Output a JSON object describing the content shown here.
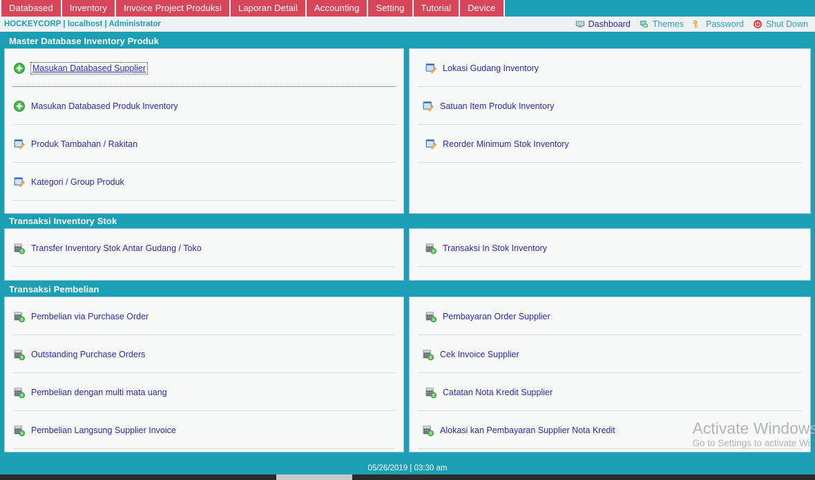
{
  "tabs": [
    {
      "label": "Databased"
    },
    {
      "label": "Inventory"
    },
    {
      "label": "Invoice Project Produksi"
    },
    {
      "label": "Laporan Detail"
    },
    {
      "label": "Accounting"
    },
    {
      "label": "Setting"
    },
    {
      "label": "Tutorial"
    },
    {
      "label": "Device"
    }
  ],
  "infobar": {
    "breadcrumb": "HOCKEYCORP | localhost | Administrator",
    "links": [
      {
        "label": "Dashboard",
        "icon": "monitor-icon",
        "active": true
      },
      {
        "label": "Themes",
        "icon": "themes-icon",
        "active": false
      },
      {
        "label": "Password",
        "icon": "key-icon",
        "active": false
      },
      {
        "label": "Shut Down",
        "icon": "power-icon",
        "active": false
      }
    ]
  },
  "sections": [
    {
      "title": "Master Database Inventory Produk",
      "left": [
        {
          "label": "Masukan Databased Supplier",
          "icon": "add-circle-icon",
          "focused": true,
          "separator": "dotted"
        },
        {
          "label": "Masukan Databased Produk Inventory",
          "icon": "add-circle-icon",
          "focused": false,
          "separator": "solid"
        },
        {
          "label": "Produk Tambahan / Rakitan",
          "icon": "note-edit-icon",
          "focused": false,
          "separator": "solid"
        },
        {
          "label": "Kategori / Group Produk",
          "icon": "note-edit-icon",
          "focused": false,
          "separator": "solid"
        }
      ],
      "right": [
        {
          "label": "Lokasi Gudang Inventory",
          "icon": "note-edit-icon",
          "focused": false,
          "separator": "solid"
        },
        {
          "label": "Satuan Item Produk Inventory",
          "icon": "note-edit-icon",
          "focused": false,
          "separator": "solid"
        },
        {
          "label": "Reorder Minimum Stok Inventory",
          "icon": "note-edit-icon",
          "focused": false,
          "separator": "solid"
        }
      ]
    },
    {
      "title": "Transaksi Inventory Stok",
      "left": [
        {
          "label": "Transfer Inventory Stok Antar Gudang / Toko",
          "icon": "register-icon",
          "focused": false,
          "separator": "solid"
        }
      ],
      "right": [
        {
          "label": "Transaksi In Stok Inventory",
          "icon": "register-icon",
          "focused": false,
          "separator": "solid"
        }
      ]
    },
    {
      "title": "Transaksi Pembelian",
      "left": [
        {
          "label": "Pembelian via Purchase Order",
          "icon": "register-icon",
          "focused": false,
          "separator": "solid"
        },
        {
          "label": "Outstanding Purchase Orders",
          "icon": "register-icon",
          "focused": false,
          "separator": "solid"
        },
        {
          "label": "Pembelian dengan multi mata uang",
          "icon": "register-icon",
          "focused": false,
          "separator": "solid"
        },
        {
          "label": "Pembelian Langsung Supplier Invoice",
          "icon": "register-icon",
          "focused": false,
          "separator": "solid"
        }
      ],
      "right": [
        {
          "label": "Pembayaran Order Supplier",
          "icon": "register-icon",
          "focused": false,
          "separator": "solid"
        },
        {
          "label": "Cek Invoice Supplier",
          "icon": "register-icon",
          "focused": false,
          "separator": "solid"
        },
        {
          "label": "Catatan Nota Kredit Supplier",
          "icon": "register-icon",
          "focused": false,
          "separator": "solid"
        },
        {
          "label": "Alokasi kan Pembayaran Supplier Nota Kredit",
          "icon": "register-icon",
          "focused": false,
          "separator": "solid"
        }
      ]
    }
  ],
  "watermark": {
    "title": "Activate Windows",
    "subtitle": "Go to Settings to activate Wi"
  },
  "statusbar": {
    "text": "05/26/2019 | 03:30 am"
  },
  "colors": {
    "teal": "#1b9fb5",
    "tab_red": "#d74559",
    "link_blue": "#2b2bb0",
    "topnav_blue": "#2aa3c0",
    "panel_bg": "#f7f8f8"
  }
}
